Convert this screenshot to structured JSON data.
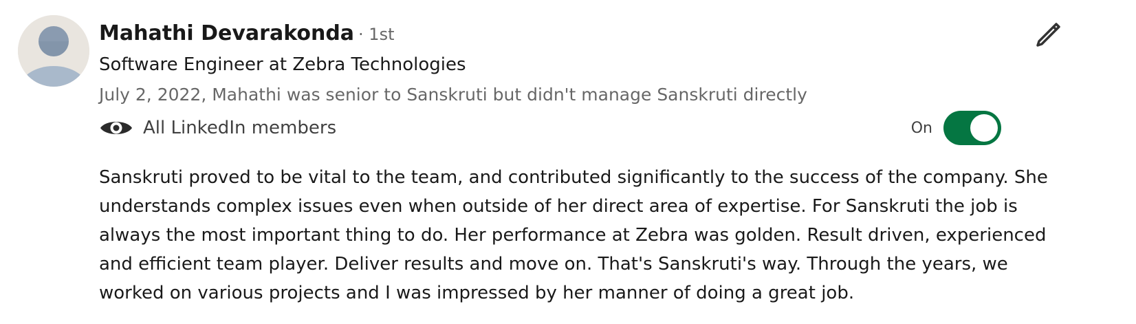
{
  "recommender": {
    "name": "Mahathi Devarakonda",
    "degree": "· 1st",
    "headline": "Software Engineer at Zebra Technologies",
    "relationship": "July 2, 2022, Mahathi was senior to Sanskruti but didn't manage Sanskruti directly",
    "avatar_icon": "default-person-avatar"
  },
  "visibility": {
    "icon": "eye-icon",
    "label": "All LinkedIn members"
  },
  "toggle": {
    "label": "On",
    "state": true,
    "color": "#057642"
  },
  "edit": {
    "icon": "pencil-icon"
  },
  "recommendation_text": "Sanskruti proved to be vital to the team, and contributed significantly to the success of the company. She understands complex issues even when outside of her direct area of expertise. For Sanskruti the job is always the most important thing to do. Her performance at Zebra was golden. Result driven, experienced and efficient team player. Deliver results and move on. That's Sanskruti's way. Through the years, we worked on various projects and I was impressed by her manner of doing a great job."
}
